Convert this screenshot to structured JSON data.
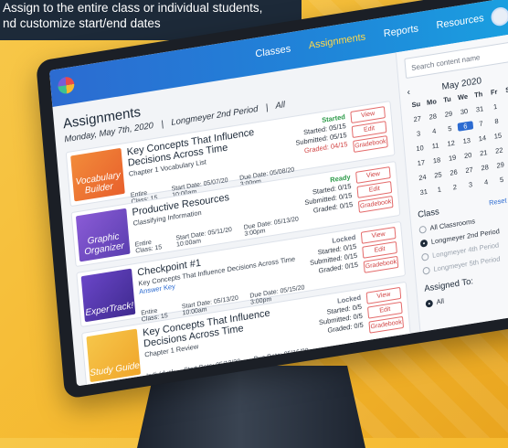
{
  "caption": {
    "line1": "Assign to the entire class or individual students,",
    "line2": "nd customize start/end dates"
  },
  "nav": {
    "links": [
      "Classes",
      "Assignments",
      "Reports",
      "Resources"
    ],
    "active": "Assignments"
  },
  "main": {
    "title": "Assignments",
    "date": "Monday, May 7th, 2020",
    "class": "Longmeyer 2nd Period",
    "filter": "All",
    "cards": [
      {
        "thumb": "Vocabulary Builder",
        "title": "Key Concepts That Influence Decisions Across Time",
        "subtitle": "Chapter 1 Vocabulary List",
        "assignee": "Entire Class: 15",
        "start": "Start Date: 05/07/20 10:00am",
        "due": "Due Date: 05/08/20 3:00pm",
        "status": "Started",
        "started": "Started: 05/15",
        "submitted": "Submitted: 05/15",
        "graded": "Graded: 04/15",
        "buttons": [
          "View",
          "Edit",
          "Gradebook"
        ]
      },
      {
        "thumb": "Graphic Organizer",
        "title": "Productive Resources",
        "subtitle": "Classifying Information",
        "assignee": "Entire Class: 15",
        "start": "Start Date: 05/11/20 10:00am",
        "due": "Due Date: 05/13/20 3:00pm",
        "status": "Ready",
        "started": "Started: 0/15",
        "submitted": "Submitted: 0/15",
        "graded": "Graded: 0/15",
        "buttons": [
          "View",
          "Edit",
          "Gradebook"
        ]
      },
      {
        "thumb": "ExperTrack!",
        "title": "Checkpoint #1",
        "subtitle": "Key Concepts That Influence Decisions Across Time",
        "link": "Answer Key",
        "assignee": "Entire Class: 15",
        "start": "Start Date: 05/13/20 10:00am",
        "due": "Due Date: 05/15/20 3:00pm",
        "status": "Locked",
        "started": "Started: 0/15",
        "submitted": "Submitted: 0/15",
        "graded": "Graded: 0/15",
        "buttons": [
          "View",
          "Edit",
          "Gradebook"
        ]
      },
      {
        "thumb": "Study Guide",
        "title": "Key Concepts That Influence Decisions Across Time",
        "subtitle": "Chapter 1 Review",
        "assignee": "Individual: 1",
        "start": "Start Date: 05/13/20 10:00am",
        "due": "Due Date: 05/16/20 3:00pm",
        "status": "Locked",
        "started": "Started: 0/5",
        "submitted": "Submitted: 0/5",
        "graded": "Graded: 0/5",
        "buttons": [
          "View",
          "Edit",
          "Gradebook"
        ]
      }
    ]
  },
  "side": {
    "search_placeholder": "Search content name",
    "month": "May 2020",
    "dow": [
      "Su",
      "Mo",
      "Tu",
      "We",
      "Th",
      "Fr",
      "Sa"
    ],
    "days": [
      "27",
      "28",
      "29",
      "30",
      "31",
      "1",
      "2",
      "3",
      "4",
      "5",
      "6",
      "7",
      "8",
      "9",
      "10",
      "11",
      "12",
      "13",
      "14",
      "15",
      "16",
      "17",
      "18",
      "19",
      "20",
      "21",
      "22",
      "23",
      "24",
      "25",
      "26",
      "27",
      "28",
      "29",
      "30",
      "31",
      "1",
      "2",
      "3",
      "4",
      "5",
      "6"
    ],
    "selected_day_index": 10,
    "class_label": "Class",
    "reset_label": "Reset Filters",
    "classes": [
      "All Classrooms",
      "Longmeyer 2nd Period",
      "Longmeyer 4th Period",
      "Longmeyer 5th Period"
    ],
    "selected_class_index": 1,
    "assigned_label": "Assigned To:",
    "assigned_value": "All"
  }
}
